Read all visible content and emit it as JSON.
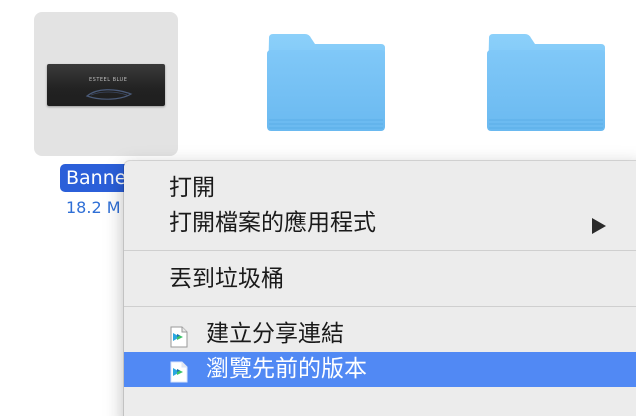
{
  "file": {
    "name": "Banne",
    "size": "18.2 M",
    "thumbnail_caption": "ESTEEL BLUE",
    "thumbnail_icon": "banner-image-thumbnail"
  },
  "folders": [
    {
      "icon": "folder-icon"
    },
    {
      "icon": "folder-icon"
    }
  ],
  "context_menu": {
    "items": [
      {
        "label": "打開"
      },
      {
        "label": "打開檔案的應用程式",
        "submenu_icon": "chevron-right-icon"
      },
      {
        "label": "丟到垃圾桶"
      },
      {
        "label": "建立分享連結",
        "icon": "sync-app-icon"
      },
      {
        "label": "瀏覽先前的版本",
        "icon": "sync-app-icon",
        "highlighted": true
      }
    ]
  },
  "colors": {
    "selection_blue": "#2b5fd9",
    "menu_highlight": "#5189f4",
    "menu_background": "#ececec",
    "folder_blue": "#6cbdf5",
    "size_text": "#2f6fd6"
  }
}
